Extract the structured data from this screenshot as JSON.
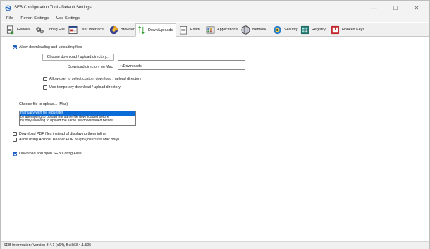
{
  "window": {
    "title": "SEB Configuration Tool - Default Settings",
    "controls": {
      "minimize": "—",
      "maximize": "☐",
      "close": "✕"
    }
  },
  "menu": [
    "File",
    "Revert Settings",
    "Use Settings"
  ],
  "tabs": [
    {
      "label": "General",
      "icon": "document-icon"
    },
    {
      "label": "Config File",
      "icon": "gears-icon"
    },
    {
      "label": "User Interface",
      "icon": "window-icon"
    },
    {
      "label": "Browser",
      "icon": "globe-icon"
    },
    {
      "label": "Down/Uploads",
      "icon": "transfer-arrows-icon",
      "active": true
    },
    {
      "label": "Exam",
      "icon": "clipboard-icon"
    },
    {
      "label": "Applications",
      "icon": "applications-icon"
    },
    {
      "label": "Network",
      "icon": "network-globe-icon"
    },
    {
      "label": "Security",
      "icon": "security-icon"
    },
    {
      "label": "Registry",
      "icon": "registry-icon"
    },
    {
      "label": "Hooked Keys",
      "icon": "keyboard-icon"
    }
  ],
  "downloads": {
    "allow_label": "Allow downloading and uploading files",
    "allow_checked": true,
    "choose_dir_button": "Choose download / upload directory...",
    "choose_dir_value": "",
    "mac_dir_label": "Download directory on Mac",
    "mac_dir_value": "~/Downloads",
    "custom_dir_label": "Allow user to select custom download / upload directory",
    "custom_dir_checked": false,
    "temp_dir_label": "Use temporary download / upload directory",
    "temp_dir_checked": false,
    "choose_file_label": "Choose file to upload... (Mac)",
    "choose_file_options": [
      "manually with file requester",
      "by attempting to upload the same file downloaded before",
      "by only allowing to upload the same file downloaded before"
    ],
    "choose_file_selected": 0,
    "pdf_inline_label": "Download PDF files instead of displaying them inline",
    "pdf_inline_checked": false,
    "acrobat_label": "Allow using Acrobat Reader PDF plugin (insecure! Mac only)",
    "acrobat_checked": false,
    "seb_config_label": "Download and open SEB Config Files",
    "seb_config_checked": true
  },
  "status": "SEB Information: Version 3.4.1 (x64), Build 3.4.1.505",
  "colors": {
    "accent": "#1f5fbf",
    "selection": "#0b6cd8"
  }
}
